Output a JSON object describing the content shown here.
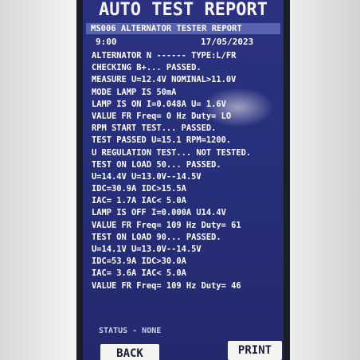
{
  "title": "AUTO TEST REPORT",
  "header": "MS006 ALTERNATOR TESTER REPORT",
  "time": "9:00",
  "date": "17/05/2023",
  "lines": [
    "ALTERNATOR N ------ TYPE:L/FR",
    "CHECKING B+... PASSED.",
    "MEASURE U=12.4V NOMINAL>11.0V",
    "MODE LAMP IS 50mA",
    "LAMP IS ON I=0.048A U= 1.6V",
    "VALUE FR Freq=   0 Hz Duty= LO",
    "RPM START TEST... PASSED.",
    "TEST PASSED U=15.1 RPM=1200.",
    "U REGULATION TEST... NOT TESTED.",
    "TEST ON LOAD 50... PASSED.",
    "U=14.4V  U=13.0V--14.5V",
    "IDC=30.9A  IDC>15.5A",
    "IAC= 1.7A  IAC< 5.0A",
    "LAMP IS OFF I=0.000A U14.4V",
    "VALUE FR Freq= 109 Hz Duty= 61",
    "TEST ON LOAD 90... PASSED.",
    "U=14.1V  U=13.0V--14.5V",
    "IDC=53.9A  IDC>30.0A",
    "IAC= 3.6A  IAC< 5.0A",
    "VALUE FR Freq= 109 Hz Duty= 46"
  ],
  "status": "STATUS - NONE",
  "buttons": {
    "back": "BACK",
    "print": "PRINT"
  },
  "colors": {
    "screen": "#2b3180",
    "header_bar": "#5a63b0",
    "text": "#ffffff",
    "button": "#f4f4f0"
  }
}
